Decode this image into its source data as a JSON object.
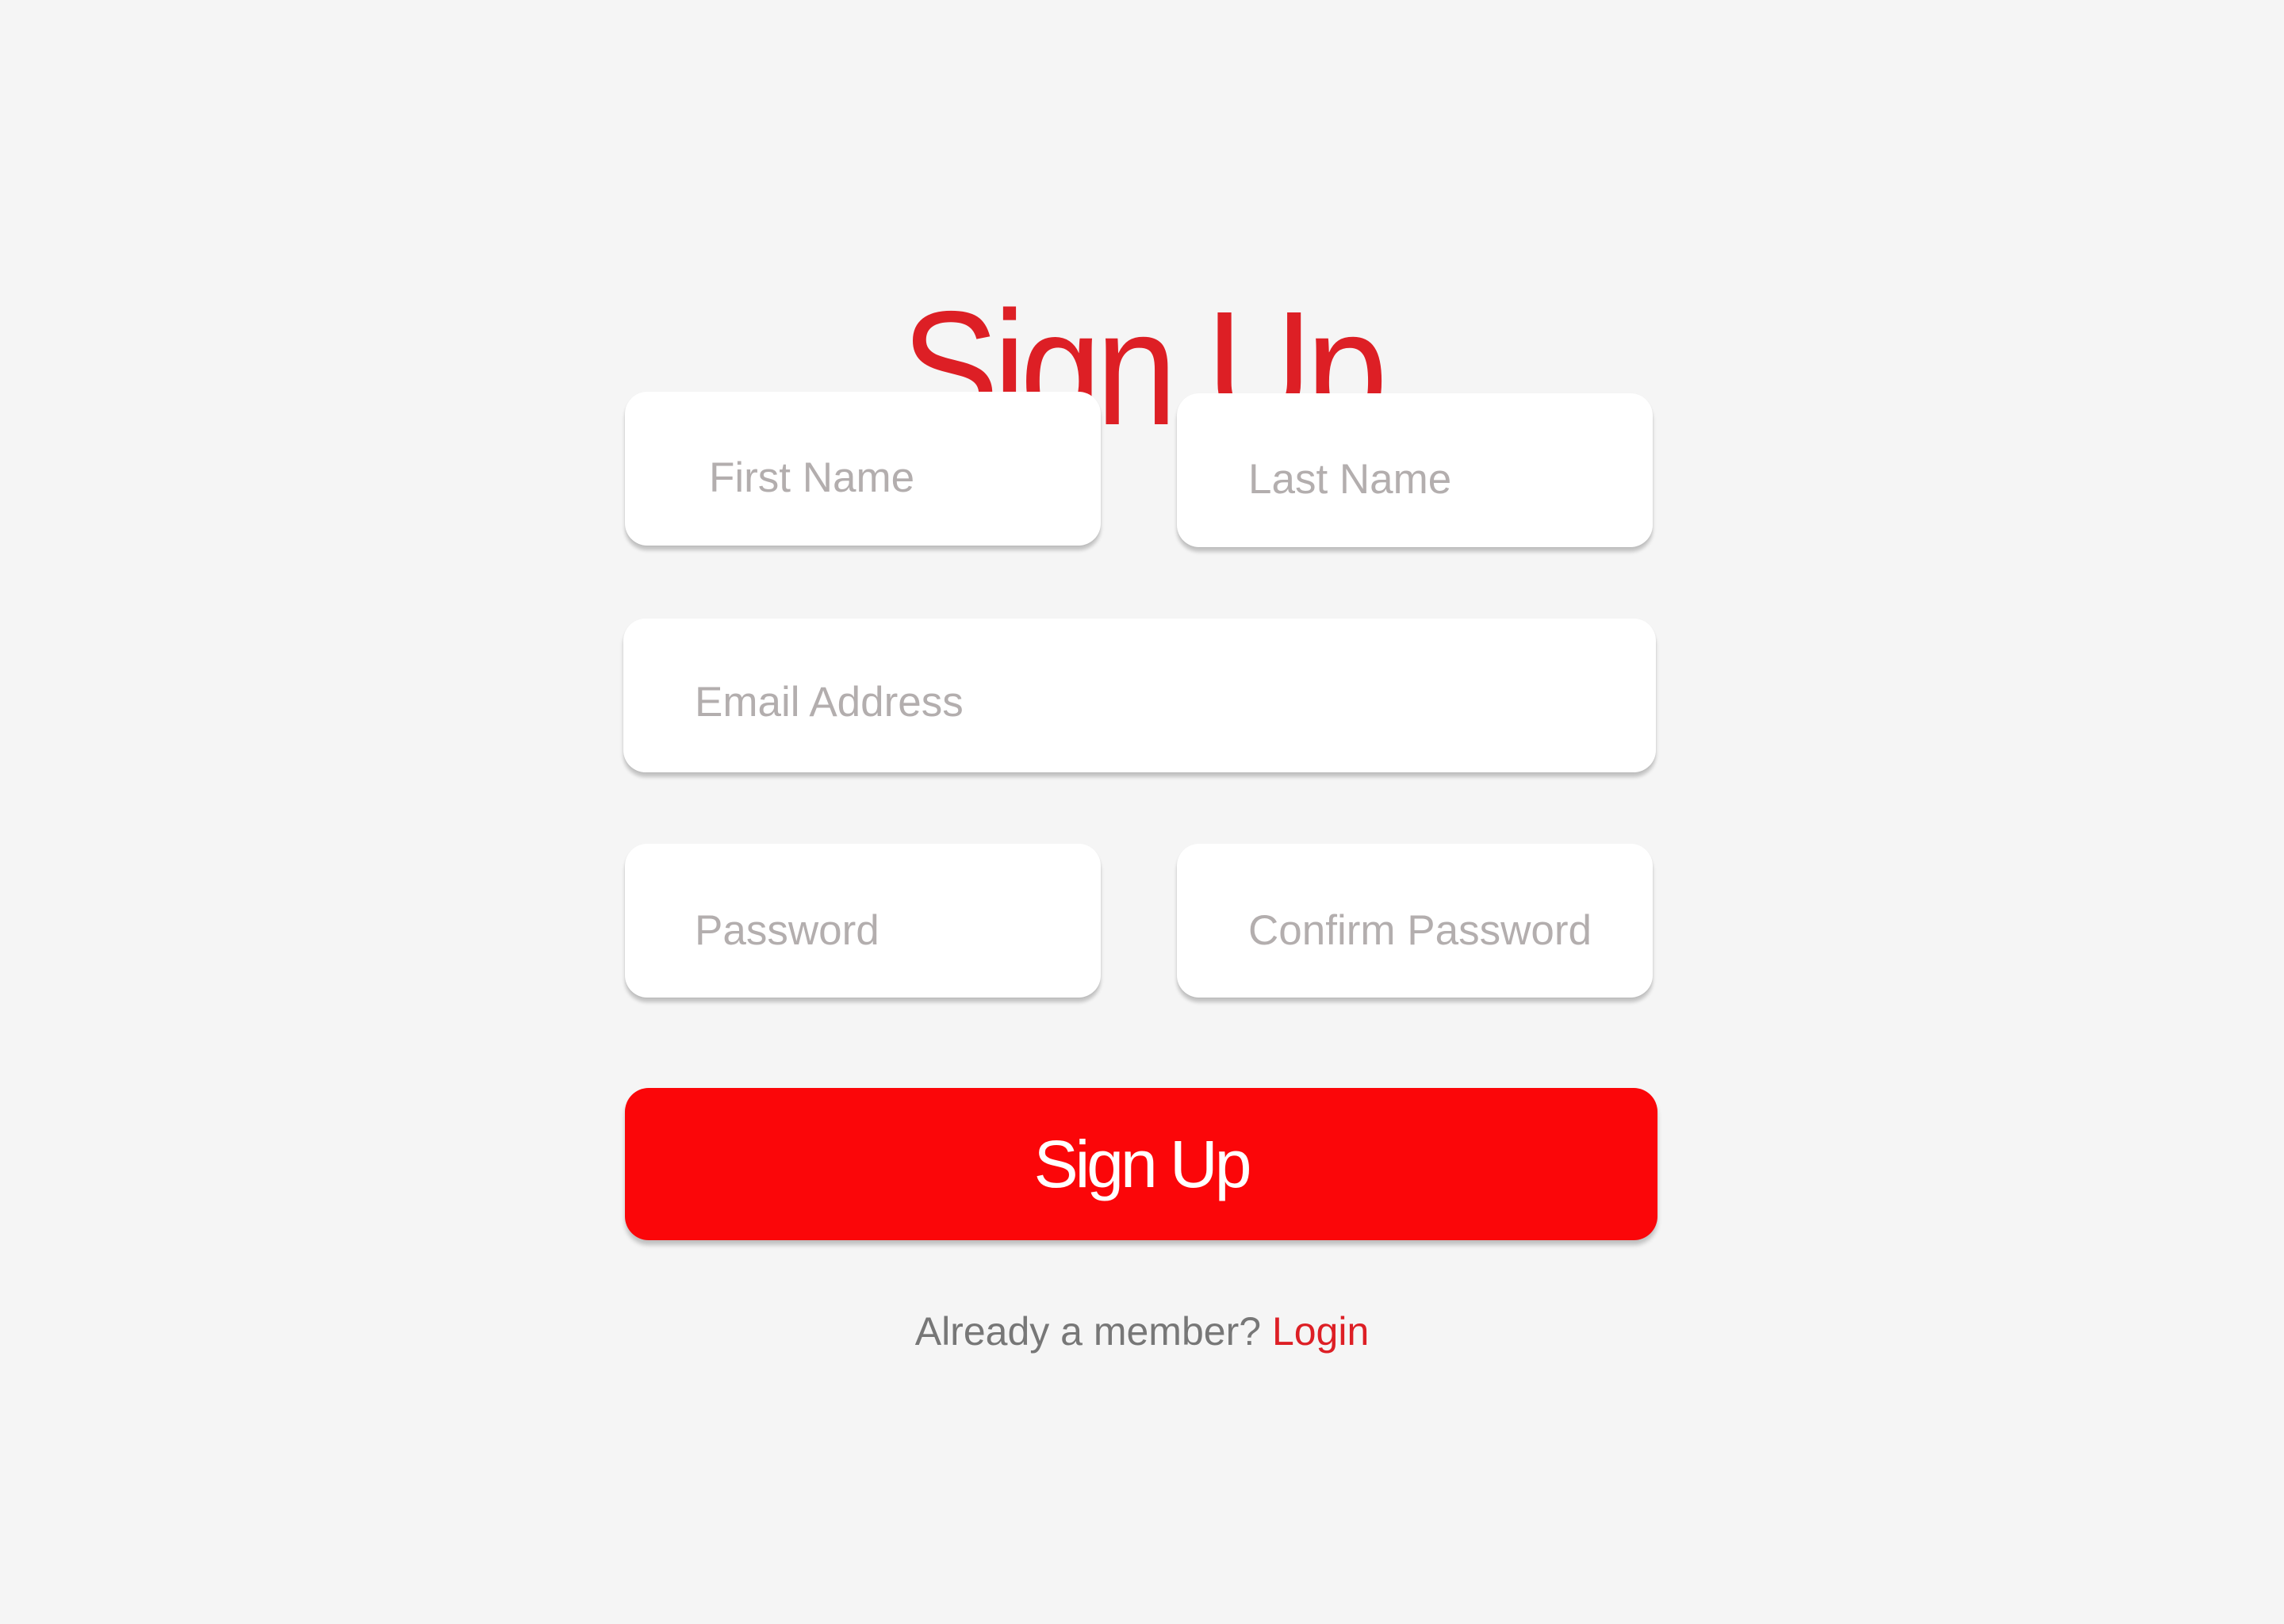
{
  "page": {
    "title": "Sign Up"
  },
  "form": {
    "first_name": {
      "value": "",
      "placeholder": "First Name"
    },
    "last_name": {
      "value": "",
      "placeholder": "Last Name"
    },
    "email": {
      "value": "",
      "placeholder": "Email Address"
    },
    "password": {
      "value": "",
      "placeholder": "Password"
    },
    "confirm_password": {
      "value": "",
      "placeholder": "Confirm Password"
    },
    "submit_label": "Sign Up"
  },
  "footer": {
    "prompt": "Already a member?",
    "login_link": "Login"
  },
  "colors": {
    "background": "#f5f5f5",
    "accent": "#dd1f25",
    "button": "#fb0609",
    "placeholder": "#b3aeae",
    "footer_text": "#777777"
  }
}
